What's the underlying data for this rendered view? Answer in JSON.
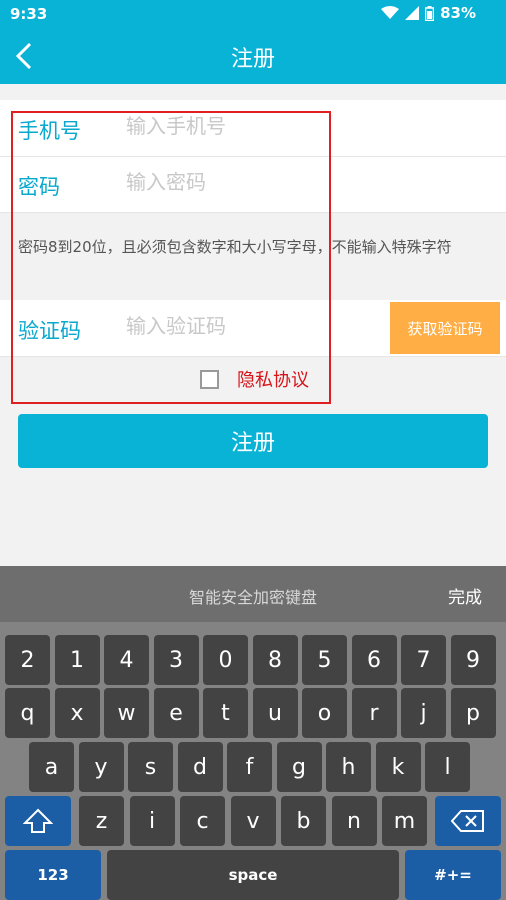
{
  "status_bar": {
    "time": "9:33",
    "battery": "83%"
  },
  "app_bar": {
    "title": "注册"
  },
  "form": {
    "phone": {
      "label": "手机号",
      "placeholder": "输入手机号",
      "value": ""
    },
    "password": {
      "label": "密码",
      "placeholder": "输入密码",
      "value": ""
    },
    "password_hint": "密码8到20位，且必须包含数字和大小写字母，不能输入特殊字符",
    "captcha": {
      "label": "验证码",
      "placeholder": "输入验证码",
      "value": "",
      "button": "获取验证码"
    },
    "privacy_label": "隐私协议",
    "privacy_checked": false,
    "submit_label": "注册"
  },
  "keyboard": {
    "title": "智能安全加密键盘",
    "done_label": "完成",
    "row1": [
      "2",
      "1",
      "4",
      "3",
      "0",
      "8",
      "5",
      "6",
      "7",
      "9"
    ],
    "row2": [
      "q",
      "x",
      "w",
      "e",
      "t",
      "u",
      "o",
      "r",
      "j",
      "p"
    ],
    "row3": [
      "a",
      "y",
      "s",
      "d",
      "f",
      "g",
      "h",
      "k",
      "l"
    ],
    "row4": [
      "z",
      "i",
      "c",
      "v",
      "b",
      "n",
      "m"
    ],
    "mode_label": "123",
    "space_label": "space",
    "symbols_label": "#+="
  },
  "colors": {
    "accent": "#08b3d6",
    "captcha_button": "#ffae45",
    "privacy_text": "#d6141b",
    "highlight_border": "#e02020"
  }
}
